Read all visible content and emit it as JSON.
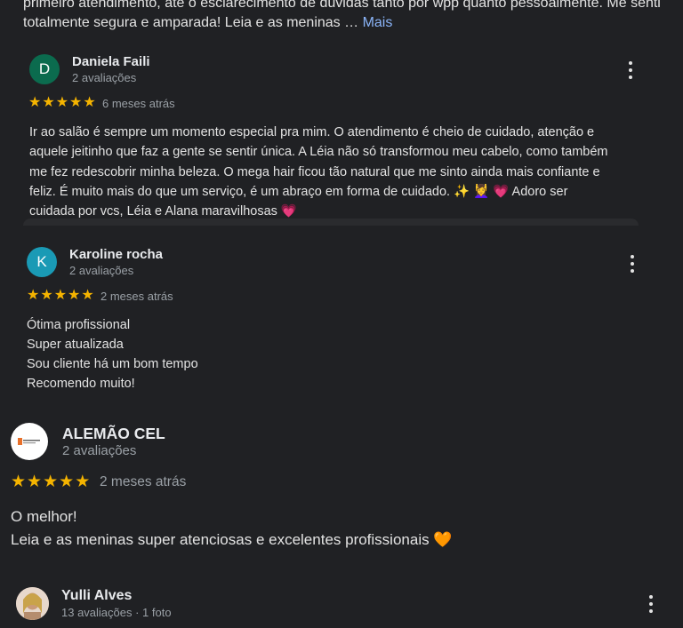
{
  "top_snippet": {
    "line1": "primeiro atendimento, até o esclarecimento de dúvidas tanto por wpp quanto pessoalmente. Me senti",
    "line2": "totalmente segura e amparada! Leia e as meninas …",
    "more_label": "Mais"
  },
  "reviews": [
    {
      "name": "Daniela Faili",
      "initial": "D",
      "avatar_color": "#0b6b4e",
      "meta": "2 avaliações",
      "rating": 5,
      "time": "6 meses atrás",
      "lines": [
        "Ir ao salão é sempre um momento especial pra mim. O atendimento é cheio de cuidado, atenção e",
        "aquele jeitinho que faz a gente se sentir única. A Léia não só transformou meu cabelo, como também",
        "me fez redescobrir minha beleza. O mega hair ficou tão natural que me sinto ainda mais confiante e",
        "feliz. É muito mais do que um serviço, é um abraço em forma de cuidado. ✨ 💆‍♀️ 💗 Adoro ser",
        "cuidada por vcs, Léia e Alana maravilhosas 💗"
      ]
    },
    {
      "name": "Karoline rocha",
      "initial": "K",
      "avatar_color": "#1a9ab5",
      "meta": "2 avaliações",
      "rating": 5,
      "time": "2 meses atrás",
      "lines": [
        "Ótima profissional",
        "Super atualizada",
        "Sou cliente há um bom tempo",
        "Recomendo muito!"
      ]
    },
    {
      "name": "ALEMÃO CEL",
      "meta": "2 avaliações",
      "rating": 5,
      "time": "2 meses atrás",
      "lines": [
        "O melhor!",
        "Leia e as meninas super atenciosas e excelentes profissionais 🧡"
      ]
    },
    {
      "name": "Yulli Alves",
      "meta": "13 avaliações · 1 foto"
    }
  ],
  "icons": {
    "star": "star-icon",
    "more": "more-vert-icon"
  },
  "colors": {
    "star": "#f5b400",
    "link": "#8ab4f8",
    "background": "#202124"
  }
}
